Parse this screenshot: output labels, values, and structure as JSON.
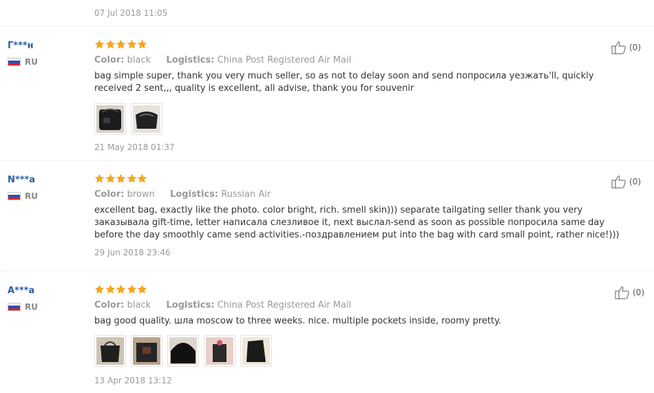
{
  "reviews": [
    {
      "user": "Г***н",
      "country": "RU",
      "rating": 5,
      "color_label": "Color:",
      "color": "black",
      "logistics_label": "Logistics:",
      "logistics": "China Post Registered Air Mail",
      "text": "bag simple super, thank you very much seller, so as not to delay soon and send попросила уезжать'll, quickly received 2 sent,,, quality is excellent, all advise, thank you for souvenir",
      "likes": "(0)",
      "date": "21 May 2018 01:37",
      "photos": [
        "photo-1",
        "photo-2"
      ]
    },
    {
      "user": "N***a",
      "country": "RU",
      "rating": 5,
      "color_label": "Color:",
      "color": "brown",
      "logistics_label": "Logistics:",
      "logistics": "Russian Air",
      "text": "excellent bag, exactly like the photo. color bright, rich. smell skin))) separate tailgating seller thank you very заказывала gift-time, letter написала слезливое it, next выслал-send as soon as possible попросила same day before the day smoothly came send activities.-поздравлением put into the bag with card small point, rather nice!)))",
      "likes": "(0)",
      "date": "29 Jun 2018 23:46",
      "photos": []
    },
    {
      "user": "A***a",
      "country": "RU",
      "rating": 5,
      "color_label": "Color:",
      "color": "black",
      "logistics_label": "Logistics:",
      "logistics": "China Post Registered Air Mail",
      "text": "bag good quality. шла moscow to three weeks. nice. multiple pockets inside, roomy pretty.",
      "likes": "(0)",
      "date": "13 Apr 2018 13:12",
      "photos": [
        "photo-1",
        "photo-2",
        "photo-3",
        "photo-4",
        "photo-5"
      ]
    }
  ],
  "top_date": "07 Jul 2018 11:05",
  "colors": {
    "star": "#f5a623",
    "username": "#2a5fa8",
    "muted": "#999999"
  },
  "icons": {
    "rating": "star-icon",
    "like": "thumbs-up-icon",
    "flag": "russia-flag-icon"
  }
}
